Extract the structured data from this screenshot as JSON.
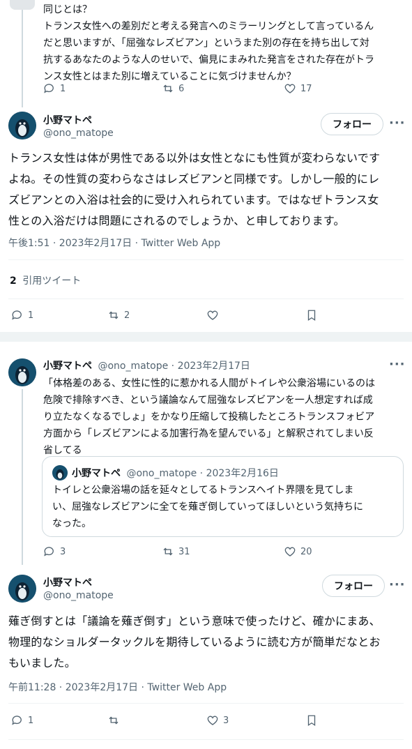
{
  "top_reply": {
    "text_lines": [
      "同じとは？",
      "トランス女性への差別だと考える発言へのミラーリングとして言っているん",
      "だと思いますが、「屈強なレズビアン」というまた別の存在を持ち出して対",
      "抗するあなたのような人のせいで、偏見にまみれた発言をされた存在がトラ",
      "ンス女性とはまた別に増えていることに気づけませんか？"
    ],
    "replies": "1",
    "retweets": "6",
    "likes": "17"
  },
  "main_tweet": {
    "name": "小野マトペ",
    "handle": "@ono_matope",
    "follow_label": "フォロー",
    "more": "···",
    "body_lines": [
      "トランス女性は体が男性である以外は女性となにも性質が変わらないです",
      "よね。その性質の変わらなさはレズビアンと同様です。しかし一般的にレ",
      "ズビアンとの入浴は社会的に受け入れられています。ではなぜトランス女",
      "性との入浴だけは問題にされるのでしょうか、と申しております。"
    ],
    "timestamp": "午後1:51 · 2023年2月17日 · Twitter Web App",
    "quote_count": "2",
    "quote_label": "引用ツイート",
    "replies": "1",
    "retweets": "2"
  },
  "thread_tweet": {
    "name": "小野マトペ",
    "handle_date": "@ono_matope · 2023年2月17日",
    "more": "···",
    "text_lines": [
      "「体格差のある、女性に性的に惹かれる人間がトイレや公衆浴場にいるのは",
      "危険で排除すべき、という議論なんて屈強なレズビアンを一人想定すれば成",
      "り立たなくなるでしょ」をかなり圧縮して投稿したところトランスフォビア",
      "方面から「レズビアンによる加害行為を望んでいる」と解釈されてしまい反",
      "省してる"
    ],
    "quoted": {
      "name": "小野マトペ",
      "handle_date": "@ono_matope · 2023年2月16日",
      "text_lines": [
        "トイレと公衆浴場の話を延々としてるトランスヘイト界隈を見てしま",
        "い、屈強なレズビアンに全てを薙ぎ倒していってほしいという気持ちに",
        "なった。"
      ]
    },
    "replies": "3",
    "retweets": "31",
    "likes": "20"
  },
  "second_tweet": {
    "name": "小野マトペ",
    "handle": "@ono_matope",
    "follow_label": "フォロー",
    "more": "···",
    "body_lines": [
      "薙ぎ倒すとは「議論を薙ぎ倒す」という意味で使ったけど、確かにまあ、",
      "物理的なショルダータックルを期待しているように読む方が簡単だなとお",
      "もいました。"
    ],
    "timestamp": "午前11:28 · 2023年2月17日 · Twitter Web App",
    "replies": "1",
    "likes": "3"
  },
  "colors": {
    "text": "#0f1419",
    "muted": "#536471",
    "border": "#cfd9de",
    "bg_gap": "#eff3f4"
  }
}
